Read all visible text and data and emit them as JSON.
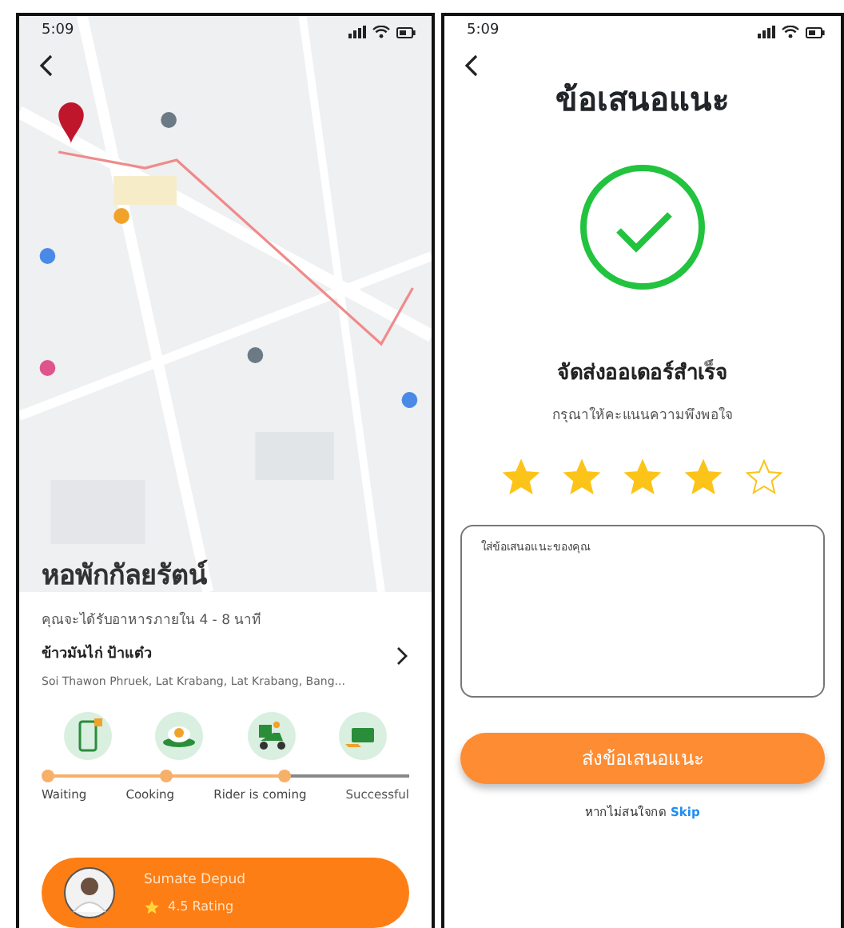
{
  "tracking_screen": {
    "status_bar": {
      "time": "5:09"
    },
    "place_title": "หอพักกัลยรัตน์",
    "eta": "คุณจะได้รับอาหารภายใน 4 - 8 นาที",
    "shop_name": "ข้าวมันไก่ ป้าแต๋ว",
    "address": "Soi Thawon Phruek, Lat Krabang, Lat Krabang, Bang...",
    "steps": [
      {
        "kind": "phone",
        "label": "Waiting",
        "reached": true
      },
      {
        "kind": "food",
        "label": "Cooking",
        "reached": true
      },
      {
        "kind": "rider",
        "label": "Rider is coming",
        "reached": true
      },
      {
        "kind": "cash",
        "label": "Successful",
        "reached": false
      }
    ],
    "rider": {
      "name": "Sumate  Depud",
      "rating": "4.5 Rating"
    }
  },
  "feedback_screen": {
    "status_bar": {
      "time": "5:09"
    },
    "title": "ข้อเสนอแนะ",
    "success_text": "จัดส่งออเดอร์สำเร็จ",
    "prompt": "กรุณาให้คะแนนความพึงพอใจ",
    "stars": 4,
    "comment": {
      "placeholder": "ใส่ข้อเสนอแนะของคุณ"
    },
    "submit_button": "ส่งข้อเสนอแนะ",
    "skip_text": "หากไม่สนใจกด",
    "skip_link": "Skip"
  }
}
